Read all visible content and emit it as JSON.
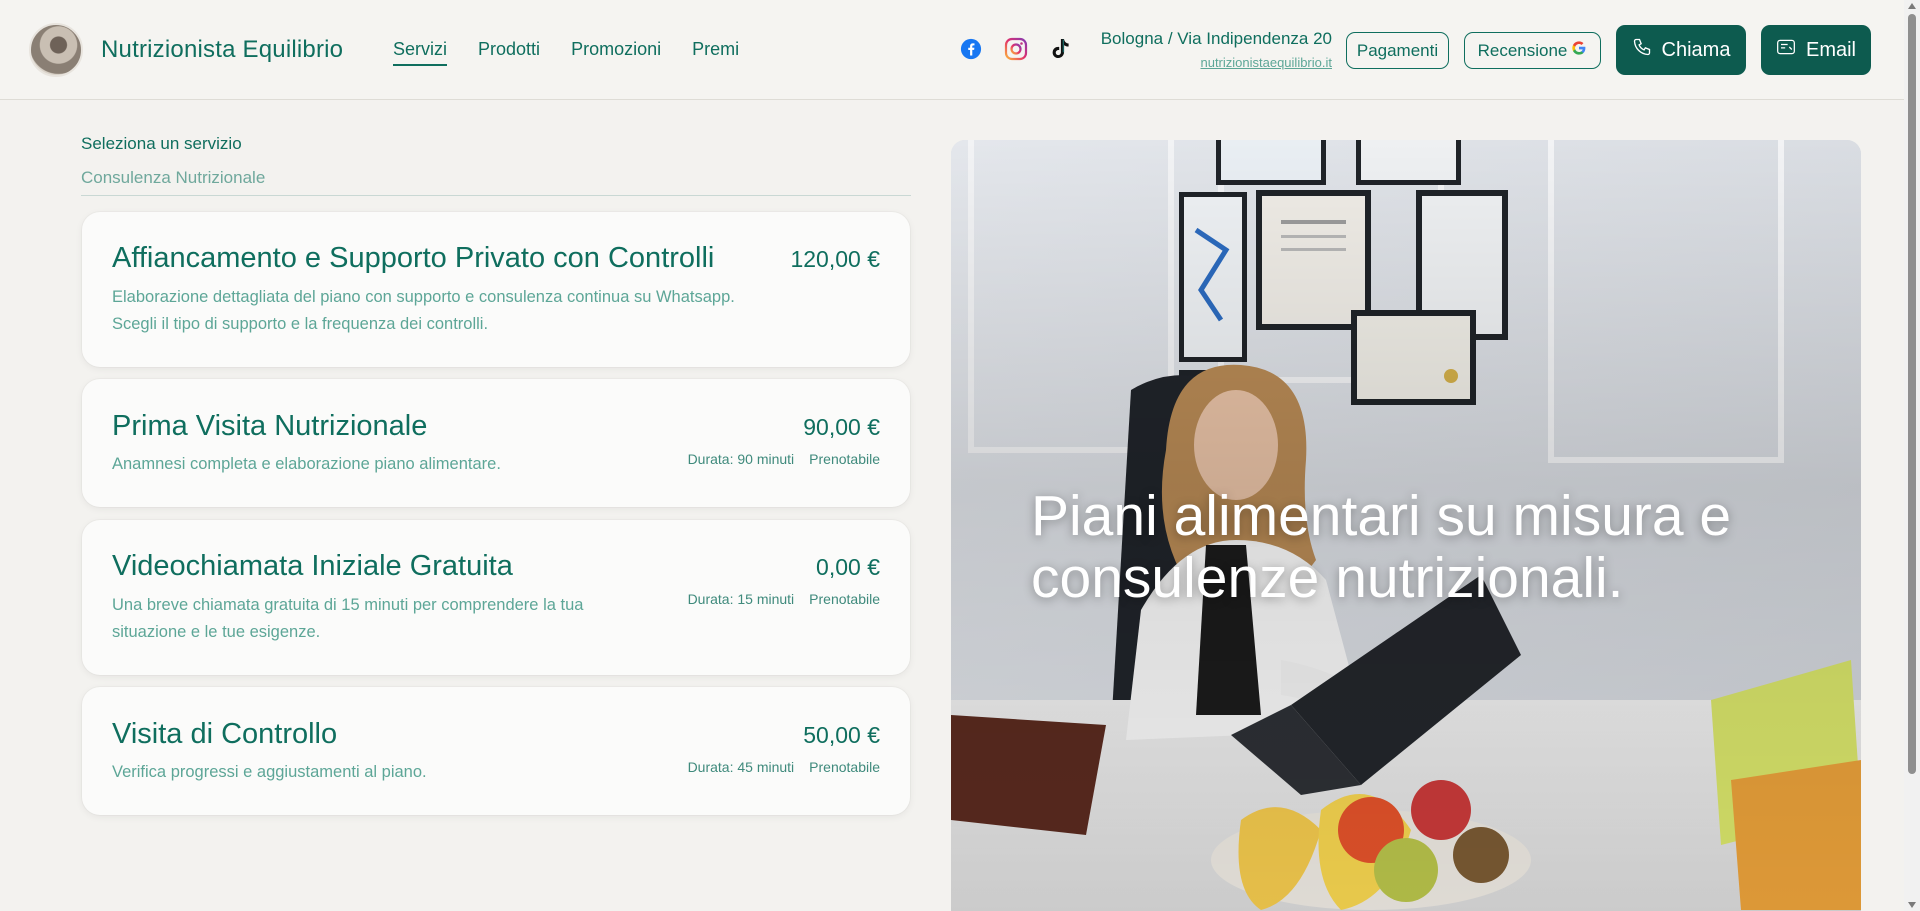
{
  "header": {
    "brand": "Nutrizionista Equilibrio",
    "nav": [
      {
        "label": "Servizi",
        "active": true
      },
      {
        "label": "Prodotti",
        "active": false
      },
      {
        "label": "Promozioni",
        "active": false
      },
      {
        "label": "Premi",
        "active": false
      }
    ],
    "social_icons": [
      "facebook-icon",
      "instagram-icon",
      "tiktok-icon"
    ],
    "address": "Bologna / Via Indipendenza 20",
    "website": "nutrizionistaequilibrio.it",
    "payments_label": "Pagamenti",
    "review_label": "Recensione",
    "call_label": "Chiama",
    "email_label": "Email"
  },
  "services": {
    "select_label": "Seleziona un servizio",
    "selected_category": "Consulenza Nutrizionale",
    "items": [
      {
        "title": "Affiancamento e Supporto Privato con Controlli",
        "description_lines": [
          "Elaborazione dettagliata del piano con supporto e consulenza continua su Whatsapp.",
          "Scegli il tipo di supporto e la frequenza dei controlli."
        ],
        "price": "120,00 €"
      },
      {
        "title": "Prima Visita Nutrizionale",
        "description_lines": [
          "Anamnesi completa e elaborazione piano alimentare."
        ],
        "price": "90,00 €",
        "duration": "Durata: 90 minuti",
        "status": "Prenotabile"
      },
      {
        "title": "Videochiamata Iniziale Gratuita",
        "description_lines": [
          "Una breve chiamata gratuita di 15 minuti per comprendere la tua",
          "situazione e le tue esigenze."
        ],
        "price": "0,00 €",
        "duration": "Durata: 15 minuti",
        "status": "Prenotabile"
      },
      {
        "title": "Visita di Controllo",
        "description_lines": [
          "Verifica progressi e aggiustamenti al piano."
        ],
        "price": "50,00 €",
        "duration": "Durata: 45 minuti",
        "status": "Prenotabile"
      }
    ]
  },
  "hero": {
    "headline_lines": [
      "Piani alimentari su misura e",
      "consulenze nutrizionali."
    ]
  },
  "colors": {
    "primary": "#0f6e5e",
    "primary_dark": "#0d5b4f",
    "muted_text": "#5da697",
    "background": "#f3f2ef"
  }
}
